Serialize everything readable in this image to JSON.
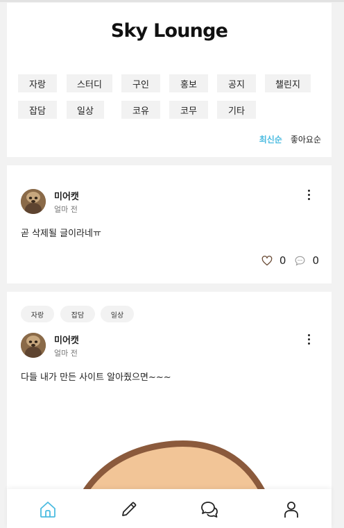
{
  "app": {
    "title": "Sky Lounge"
  },
  "categories": [
    "자랑",
    "스터디",
    "구인",
    "홍보",
    "공지",
    "챌린지",
    "잡담",
    "일상",
    "코유",
    "코무",
    "기타"
  ],
  "sort": {
    "latest": "최신순",
    "likes": "좋아요순",
    "active": "latest"
  },
  "posts": [
    {
      "author": "미어캣",
      "time": "얼마 전",
      "text": "곧 삭제될 글이라네ㅠ",
      "likes": "0",
      "comments": "0",
      "tags": []
    },
    {
      "author": "미어캣",
      "time": "얼마 전",
      "text": "다들 내가 만든 사이트 알아줬으면~~~",
      "tags": [
        "자랑",
        "잡담",
        "일상"
      ]
    }
  ],
  "colors": {
    "accent": "#4bbbe0",
    "chip_bg": "#f2f2f2",
    "page_bg": "#f2f2f2"
  },
  "icons": {
    "more": "kebab-vertical-icon",
    "like": "heart-outline-icon",
    "comment": "chat-bubble-icon",
    "nav": [
      "home-icon",
      "pencil-icon",
      "chat-icon",
      "user-icon"
    ]
  }
}
